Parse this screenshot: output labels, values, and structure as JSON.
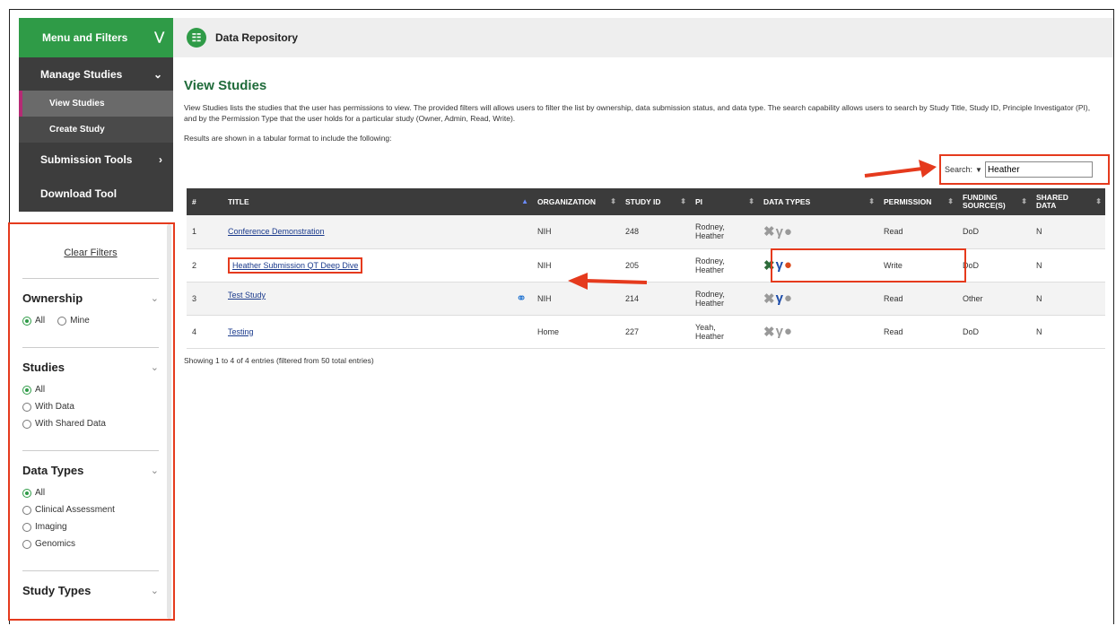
{
  "sidebar": {
    "header_label": "Menu and Filters",
    "nav": [
      {
        "label": "Manage Studies"
      },
      {
        "label": "View Studies"
      },
      {
        "label": "Create Study"
      },
      {
        "label": "Submission Tools"
      },
      {
        "label": "Download Tool"
      }
    ],
    "clear_filters": "Clear Filters",
    "filters": {
      "ownership": {
        "title": "Ownership",
        "options": [
          "All",
          "Mine"
        ],
        "selected": "All"
      },
      "studies": {
        "title": "Studies",
        "options": [
          "All",
          "With Data",
          "With Shared Data"
        ],
        "selected": "All"
      },
      "data_types": {
        "title": "Data Types",
        "options": [
          "All",
          "Clinical Assessment",
          "Imaging",
          "Genomics"
        ],
        "selected": "All"
      },
      "study_types": {
        "title": "Study Types"
      }
    }
  },
  "topbar": {
    "title": "Data Repository"
  },
  "main": {
    "title": "View Studies",
    "description": "View Studies lists the studies that the user has permissions to view. The provided filters will allows users to filter the list by ownership, data submission status, and data type. The search capability allows users to search by Study Title, Study ID, Principle Investigator (PI), and by the Permission Type that the user holds for a particular study (Owner, Admin, Read, Write).",
    "results_note": "Results are shown in a tabular format to include the following:",
    "search_label": "Search:",
    "search_value": "Heather",
    "footer": "Showing 1 to 4 of 4 entries (filtered from 50 total entries)"
  },
  "table": {
    "headers": {
      "num": "#",
      "title": "TITLE",
      "organization": "ORGANIZATION",
      "study_id": "STUDY ID",
      "pi": "PI",
      "data_types": "DATA TYPES",
      "permission": "PERMISSION",
      "funding_line1": "FUNDING",
      "funding_line2": "SOURCE(S)",
      "shared_line1": "SHARED",
      "shared_line2": "DATA"
    },
    "rows": [
      {
        "num": "1",
        "title": "Conference Demonstration",
        "organization": "NIH",
        "study_id": "248",
        "pi_line1": "Rodney,",
        "pi_line2": "Heather",
        "permission": "Read",
        "funding": "DoD",
        "shared": "N"
      },
      {
        "num": "2",
        "title": "Heather Submission QT Deep Dive",
        "organization": "NIH",
        "study_id": "205",
        "pi_line1": "Rodney,",
        "pi_line2": "Heather",
        "permission": "Write",
        "funding": "DoD",
        "shared": "N"
      },
      {
        "num": "3",
        "title": "Test Study",
        "organization": "NIH",
        "study_id": "214",
        "pi_line1": "Rodney,",
        "pi_line2": "Heather",
        "permission": "Read",
        "funding": "Other",
        "shared": "N"
      },
      {
        "num": "4",
        "title": "Testing",
        "organization": "Home",
        "study_id": "227",
        "pi_line1": "Yeah,",
        "pi_line2": "Heather",
        "permission": "Read",
        "funding": "DoD",
        "shared": "N"
      }
    ]
  },
  "icons": {
    "data_type_genomics": "dna-icon",
    "data_type_imaging": "y-icon",
    "data_type_clinical": "head-icon",
    "attachment": "paperclip-icon"
  },
  "colors": {
    "brand_green": "#2f9b47",
    "sidebar_dark": "#3d3d3d",
    "annotation_red": "#e53a1d",
    "link_blue": "#1a3a8c"
  }
}
